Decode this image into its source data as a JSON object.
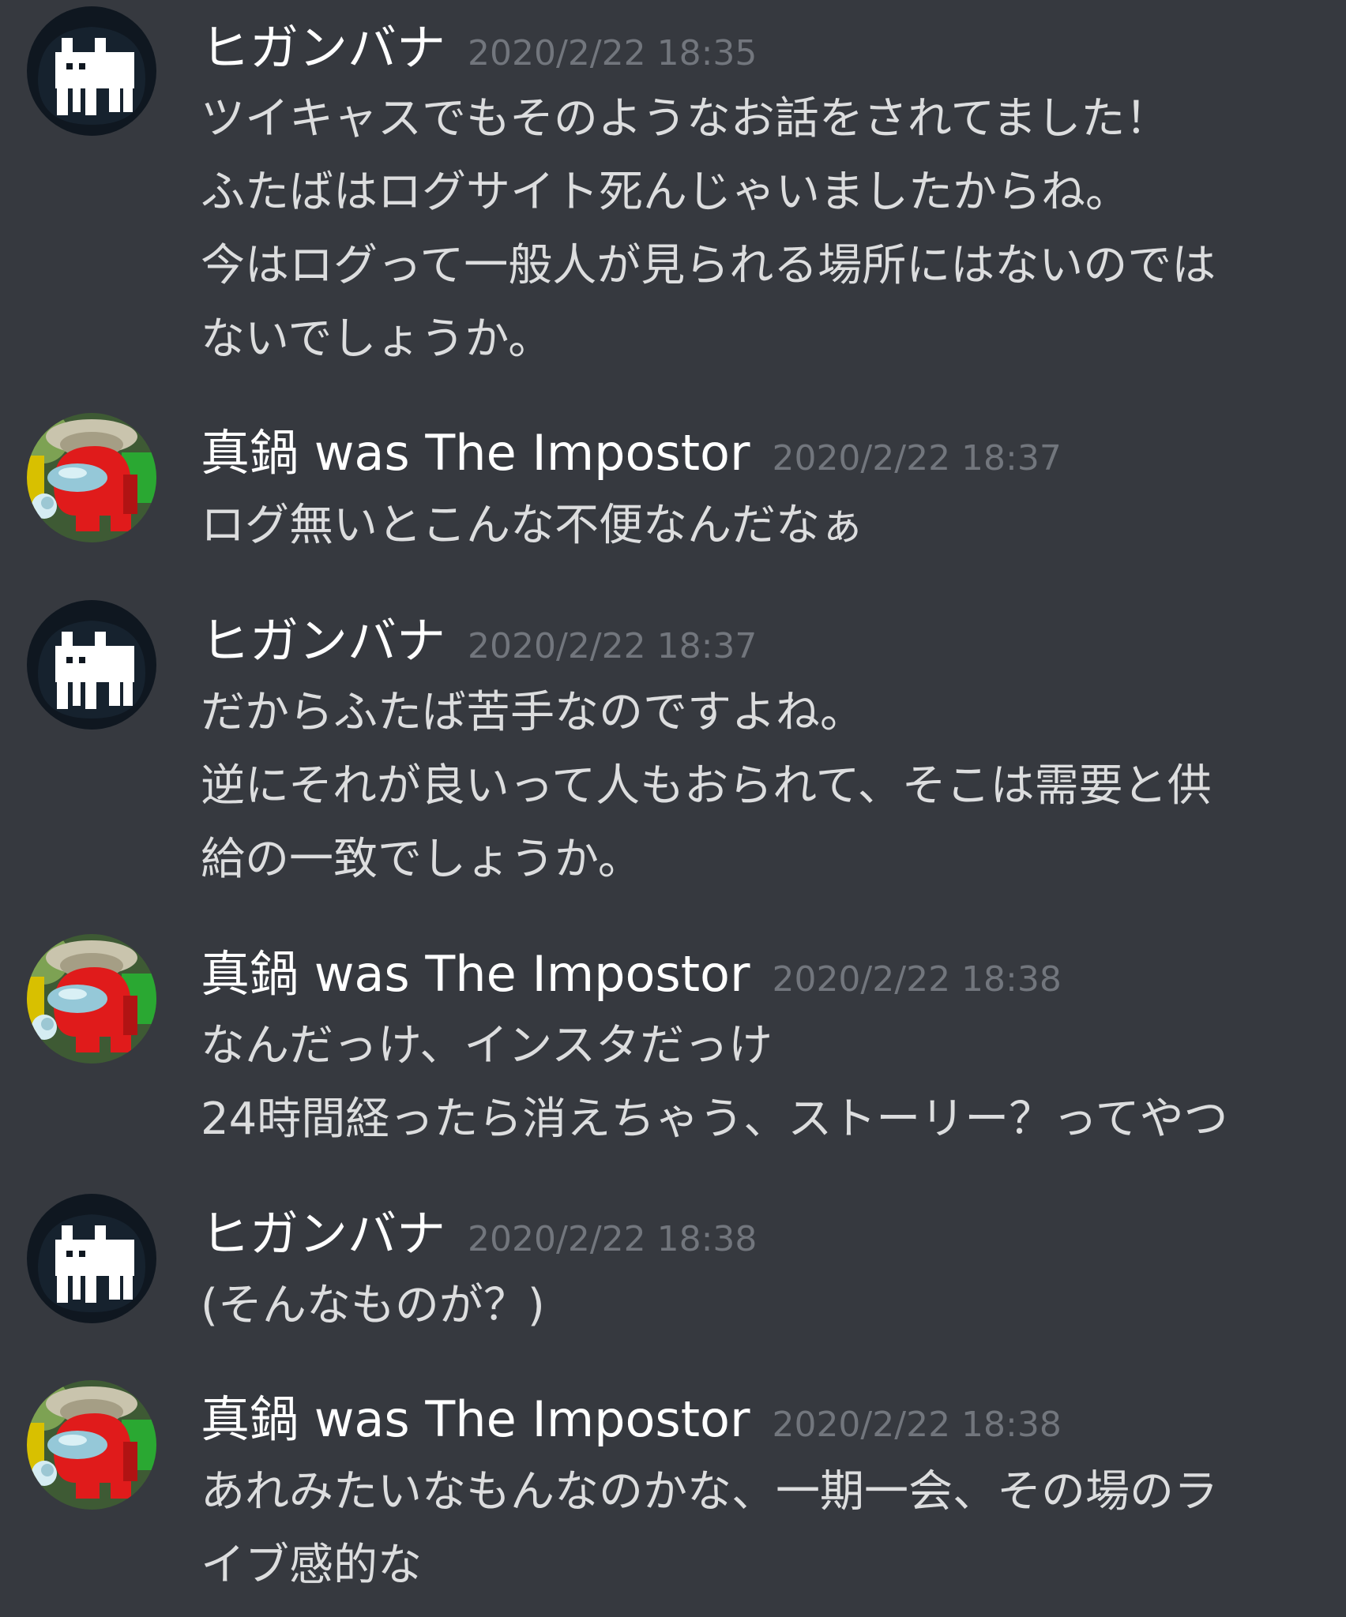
{
  "messages": [
    {
      "author": "ヒガンバナ",
      "avatar": "white-creature-icon",
      "timestamp": "2020/2/22 18:35",
      "lines": [
        "ツイキャスでもそのようなお話をされてました！",
        "ふたばはログサイト死んじゃいましたからね。",
        "今はログって一般人が見られる場所にはないのでは",
        "ないでしょうか。"
      ]
    },
    {
      "author": "真鍋 was The Impostor",
      "avatar": "red-crewmate-icon",
      "timestamp": "2020/2/22 18:37",
      "lines": [
        "ログ無いとこんな不便なんだなぁ"
      ]
    },
    {
      "author": "ヒガンバナ",
      "avatar": "white-creature-icon",
      "timestamp": "2020/2/22 18:37",
      "lines": [
        "だからふたば苦手なのですよね。",
        "逆にそれが良いって人もおられて、そこは需要と供",
        "給の一致でしょうか。"
      ]
    },
    {
      "author": "真鍋 was The Impostor",
      "avatar": "red-crewmate-icon",
      "timestamp": "2020/2/22 18:38",
      "lines": [
        "なんだっけ、インスタだっけ",
        "24時間経ったら消えちゃう、ストーリー？ってやつ"
      ]
    },
    {
      "author": "ヒガンバナ",
      "avatar": "white-creature-icon",
      "timestamp": "2020/2/22 18:38",
      "lines": [
        "(そんなものが？)"
      ]
    },
    {
      "author": "真鍋 was The Impostor",
      "avatar": "red-crewmate-icon",
      "timestamp": "2020/2/22 18:38",
      "lines": [
        "あれみたいなもんなのかな、一期一会、その場のラ",
        "イブ感的な"
      ]
    }
  ],
  "colors": {
    "background": "#36393f",
    "username": "#ffffff",
    "timestamp": "#72767d",
    "text": "#dcddde"
  }
}
